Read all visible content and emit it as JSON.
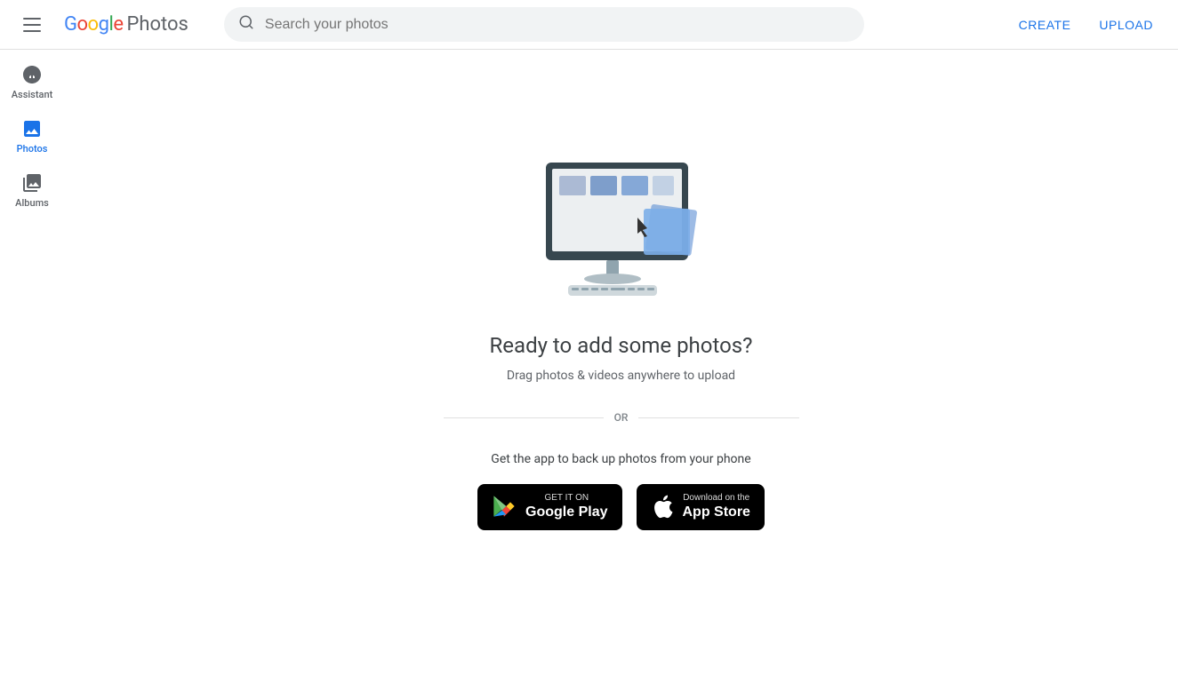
{
  "header": {
    "menu_icon": "hamburger-menu",
    "logo_google": "Google",
    "logo_product": "Photos",
    "search_placeholder": "Search your photos",
    "create_label": "CREATE",
    "upload_label": "UPLOAD"
  },
  "sidebar": {
    "items": [
      {
        "id": "assistant",
        "label": "Assistant",
        "icon": "assistant",
        "active": false
      },
      {
        "id": "photos",
        "label": "Photos",
        "icon": "photos",
        "active": true
      },
      {
        "id": "albums",
        "label": "Albums",
        "icon": "albums",
        "active": false
      }
    ]
  },
  "main": {
    "title": "Ready to add some photos?",
    "subtitle": "Drag photos & videos anywhere to upload",
    "divider_text": "OR",
    "app_cta": "Get the app to back up photos from your phone",
    "google_play_pre": "GET IT ON",
    "google_play_store": "Google Play",
    "app_store_pre": "Download on the",
    "app_store_name": "App Store"
  }
}
